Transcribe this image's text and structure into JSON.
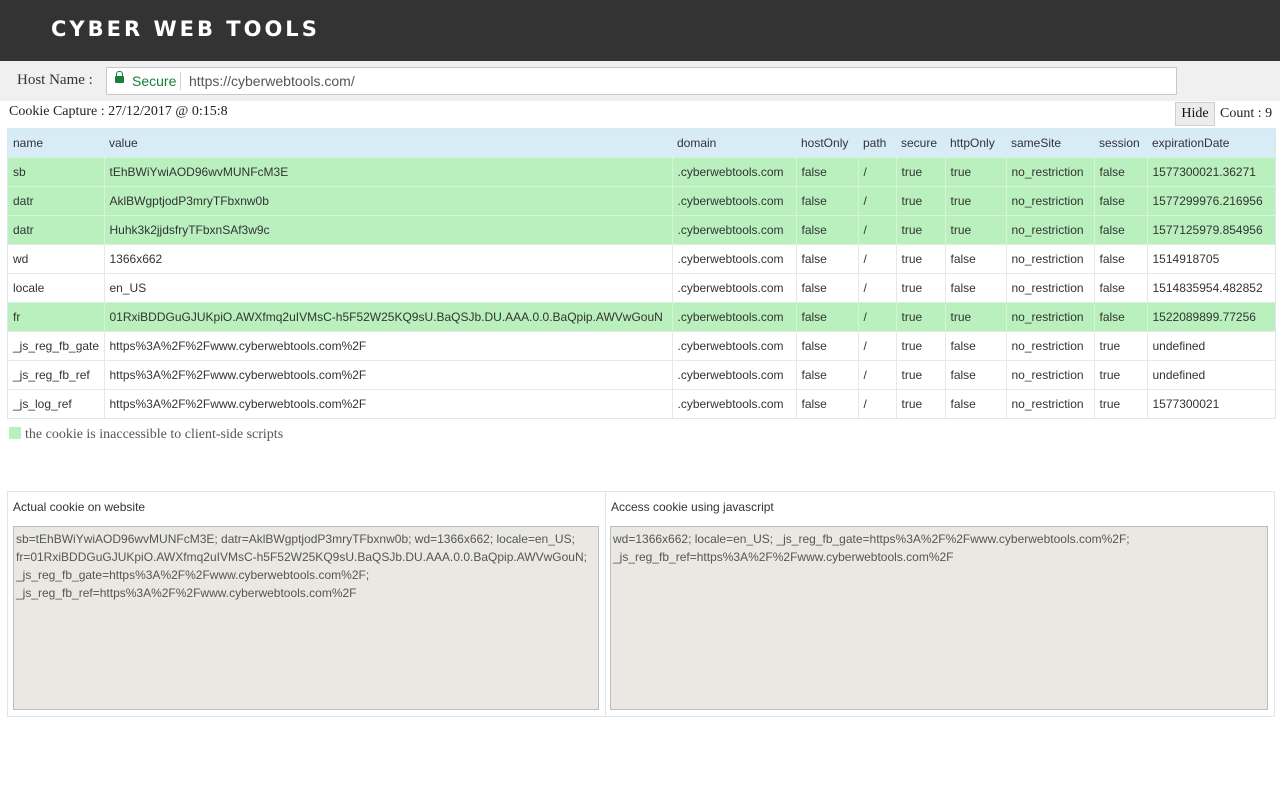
{
  "header": {
    "brand": "CYBER WEB TOOLS"
  },
  "host": {
    "label": "Host Name :",
    "secure_label": "Secure",
    "url": "https://cyberwebtools.com/",
    "secure_color": "#188038"
  },
  "capture": {
    "label": "Cookie Capture : 27/12/2017 @ 0:15:8",
    "hide_label": "Hide",
    "count_label": "Count : 9"
  },
  "table": {
    "columns": [
      "name",
      "value",
      "domain",
      "hostOnly",
      "path",
      "secure",
      "httpOnly",
      "sameSite",
      "session",
      "expirationDate"
    ],
    "rows": [
      [
        "sb",
        "tEhBWiYwiAOD96wvMUNFcM3E",
        ".cyberwebtools.com",
        "false",
        "/",
        "true",
        "true",
        "no_restriction",
        "false",
        "1577300021.36271"
      ],
      [
        "datr",
        "AklBWgptjodP3mryTFbxnw0b",
        ".cyberwebtools.com",
        "false",
        "/",
        "true",
        "true",
        "no_restriction",
        "false",
        "1577299976.216956"
      ],
      [
        "datr",
        "Huhk3k2jjdsfryTFbxnSAf3w9c",
        ".cyberwebtools.com",
        "false",
        "/",
        "true",
        "true",
        "no_restriction",
        "false",
        "1577125979.854956"
      ],
      [
        "wd",
        "1366x662",
        ".cyberwebtools.com",
        "false",
        "/",
        "true",
        "false",
        "no_restriction",
        "false",
        "1514918705"
      ],
      [
        "locale",
        "en_US",
        ".cyberwebtools.com",
        "false",
        "/",
        "true",
        "false",
        "no_restriction",
        "false",
        "1514835954.482852"
      ],
      [
        "fr",
        "01RxiBDDGuGJUKpiO.AWXfmq2uIVMsC-h5F52W25KQ9sU.BaQSJb.DU.AAA.0.0.BaQpip.AWVwGouN",
        ".cyberwebtools.com",
        "false",
        "/",
        "true",
        "true",
        "no_restriction",
        "false",
        "1522089899.77256"
      ],
      [
        "_js_reg_fb_gate",
        "https%3A%2F%2Fwww.cyberwebtools.com%2F",
        ".cyberwebtools.com",
        "false",
        "/",
        "true",
        "false",
        "no_restriction",
        "true",
        "undefined"
      ],
      [
        "_js_reg_fb_ref",
        "https%3A%2F%2Fwww.cyberwebtools.com%2F",
        ".cyberwebtools.com",
        "false",
        "/",
        "true",
        "false",
        "no_restriction",
        "true",
        "undefined"
      ],
      [
        "_js_log_ref",
        "https%3A%2F%2Fwww.cyberwebtools.com%2F",
        ".cyberwebtools.com",
        "false",
        "/",
        "true",
        "false",
        "no_restriction",
        "true",
        "1577300021"
      ]
    ],
    "highlight_color": "#b9f0bd"
  },
  "legend": {
    "text": "the cookie is inaccessible to client-side scripts"
  },
  "panels": {
    "actual": {
      "title": "Actual cookie on website",
      "lines": [
        " sb=tEhBWiYwiAOD96wvMUNFcM3E; datr=AklBWgptjodP3mryTFbxnw0b; wd=1366x662; locale=en_US;",
        "fr=01RxiBDDGuGJUKpiO.AWXfmq2uIVMsC-h5F52W25KQ9sU.BaQSJb.DU.AAA.0.0.BaQpip.AWVwGouN;",
        "_js_reg_fb_gate=https%3A%2F%2Fwww.cyberwebtools.com%2F;",
        "_js_reg_fb_ref=https%3A%2F%2Fwww.cyberwebtools.com%2F"
      ]
    },
    "javascript": {
      "title": "Access cookie using javascript",
      "lines": [
        "wd=1366x662; locale=en_US; _js_reg_fb_gate=https%3A%2F%2Fwww.cyberwebtools.com%2F;",
        "_js_reg_fb_ref=https%3A%2F%2Fwww.cyberwebtools.com%2F"
      ]
    }
  }
}
